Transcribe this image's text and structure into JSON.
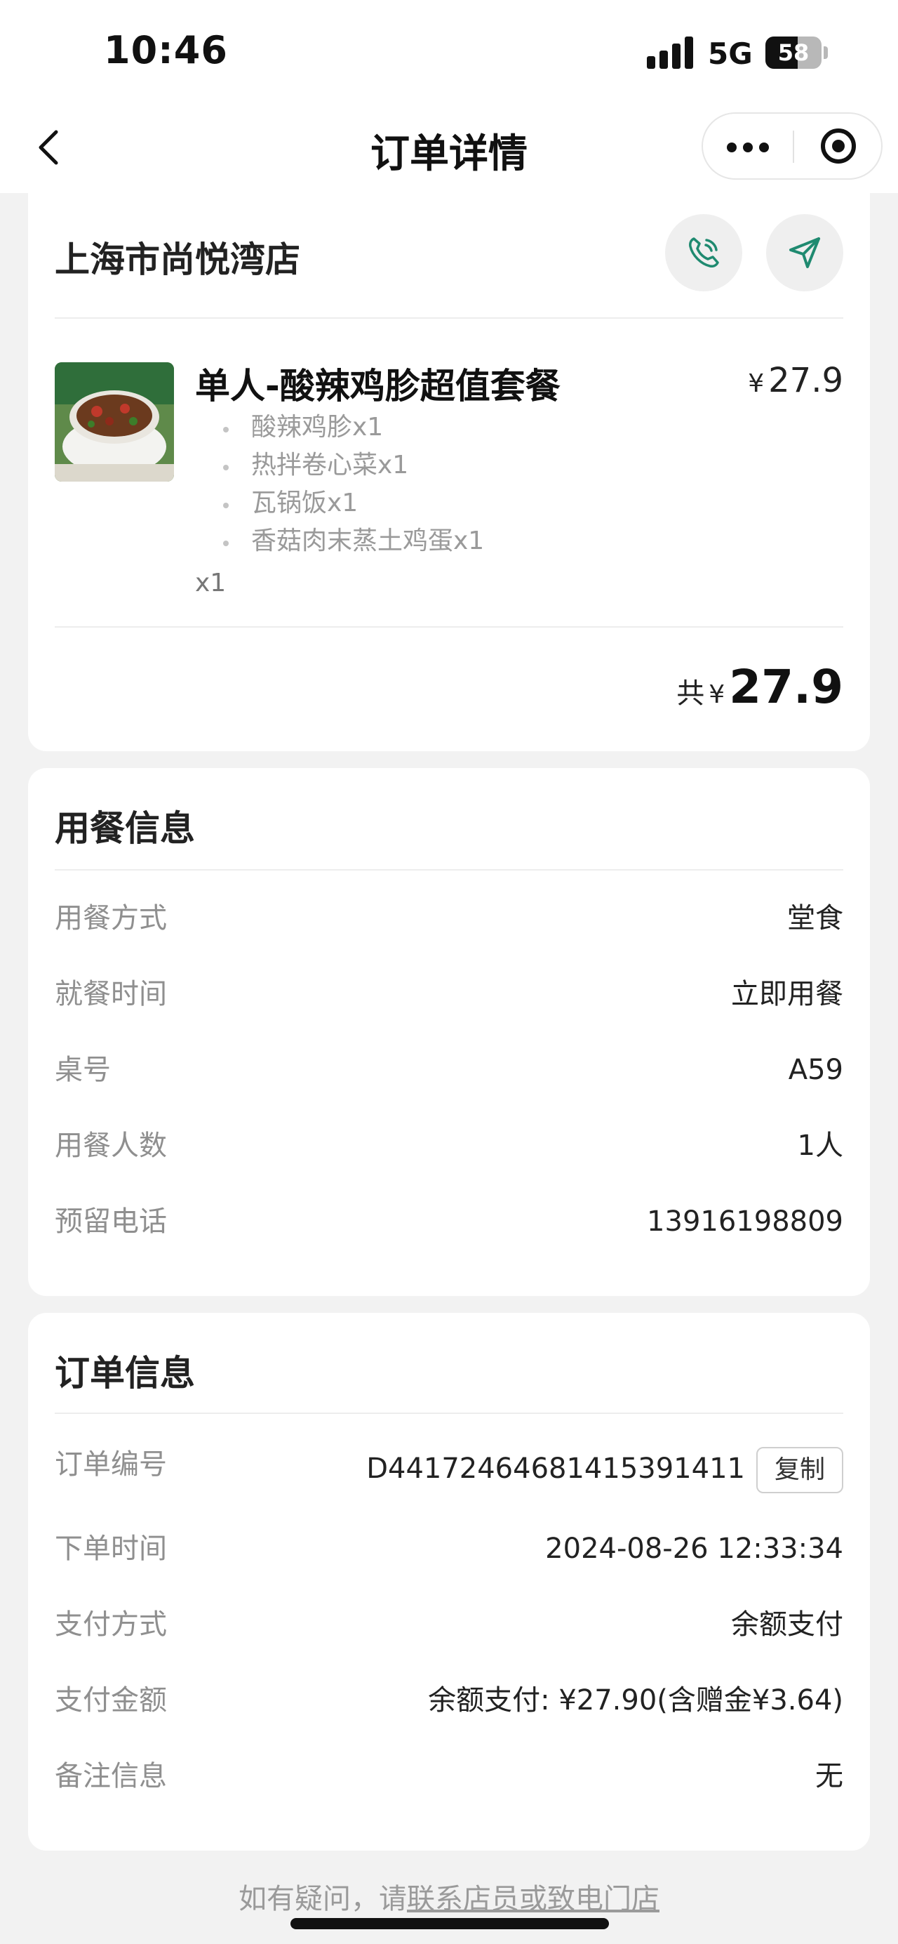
{
  "status_bar": {
    "time": "10:46",
    "network": "5G",
    "battery_text": "58",
    "battery_level_percent": 58
  },
  "nav": {
    "title": "订单详情"
  },
  "store": {
    "name": "上海市尚悦湾店",
    "item": {
      "name": "单人-酸辣鸡胗超值套餐",
      "currency": "¥",
      "price": "27.9",
      "sub_items": [
        "酸辣鸡胗x1",
        "热拌卷心菜x1",
        "瓦锅饭x1",
        "香菇肉末蒸土鸡蛋x1"
      ],
      "quantity": "x1"
    },
    "total": {
      "label": "共",
      "currency": "¥",
      "amount": "27.9"
    }
  },
  "dining_info": {
    "title": "用餐信息",
    "rows": [
      {
        "label": "用餐方式",
        "value": "堂食"
      },
      {
        "label": "就餐时间",
        "value": "立即用餐"
      },
      {
        "label": "桌号",
        "value": "A59"
      },
      {
        "label": "用餐人数",
        "value": "1人"
      },
      {
        "label": "预留电话",
        "value": "13916198809"
      }
    ]
  },
  "order_info": {
    "title": "订单信息",
    "order_no": {
      "label": "订单编号",
      "value": "D44172464681415391411",
      "copy_label": "复制"
    },
    "rows": [
      {
        "label": "下单时间",
        "value": "2024-08-26 12:33:34"
      },
      {
        "label": "支付方式",
        "value": "余额支付"
      },
      {
        "label": "支付金额",
        "value": "余额支付: ¥27.90(含赠金¥3.64)"
      },
      {
        "label": "备注信息",
        "value": "无"
      }
    ]
  },
  "footer": {
    "prefix": "如有疑问，请",
    "link": "联系店员或致电门店"
  },
  "colors": {
    "accent": "#1f8a70",
    "background": "#f2f2f2",
    "muted_text": "#8f8f8f"
  }
}
